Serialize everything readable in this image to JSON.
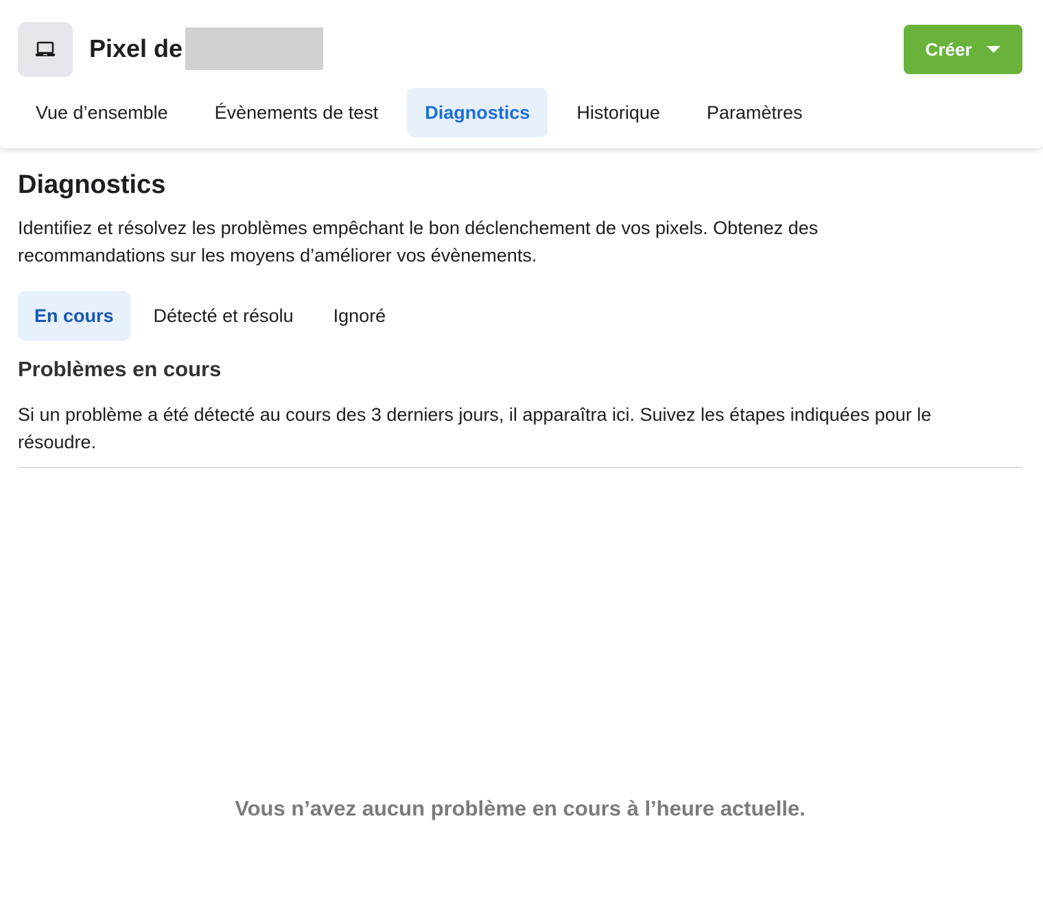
{
  "header": {
    "pixel_icon": "laptop-icon",
    "title": "Pixel de",
    "create_button": {
      "label": "Créer",
      "icon": "caret-down-icon",
      "color": "#69b33a"
    }
  },
  "tabs": [
    {
      "label": "Vue d’ensemble",
      "active": false
    },
    {
      "label": "Évènements de test",
      "active": false
    },
    {
      "label": "Diagnostics",
      "active": true
    },
    {
      "label": "Historique",
      "active": false
    },
    {
      "label": "Paramètres",
      "active": false
    }
  ],
  "diagnostics": {
    "title": "Diagnostics",
    "description": "Identifiez et résolvez les problèmes empêchant le bon déclenchement de vos pixels. Obtenez des recommandations sur les moyens d’améliorer vos évènements."
  },
  "subtabs": [
    {
      "label": "En cours",
      "active": true
    },
    {
      "label": "Détecté et résolu",
      "active": false
    },
    {
      "label": "Ignoré",
      "active": false
    }
  ],
  "problems": {
    "title": "Problèmes en cours",
    "description": "Si un problème a été détecté au cours des 3 derniers jours, il apparaîtra ici. Suivez les étapes indiquées pour le résoudre.",
    "empty_message": "Vous n’avez aucun problème en cours à l’heure actuelle."
  },
  "colors": {
    "accent": "#1a6ed8",
    "active_tab_bg": "#e7f0fd",
    "create_green": "#69b33a"
  }
}
